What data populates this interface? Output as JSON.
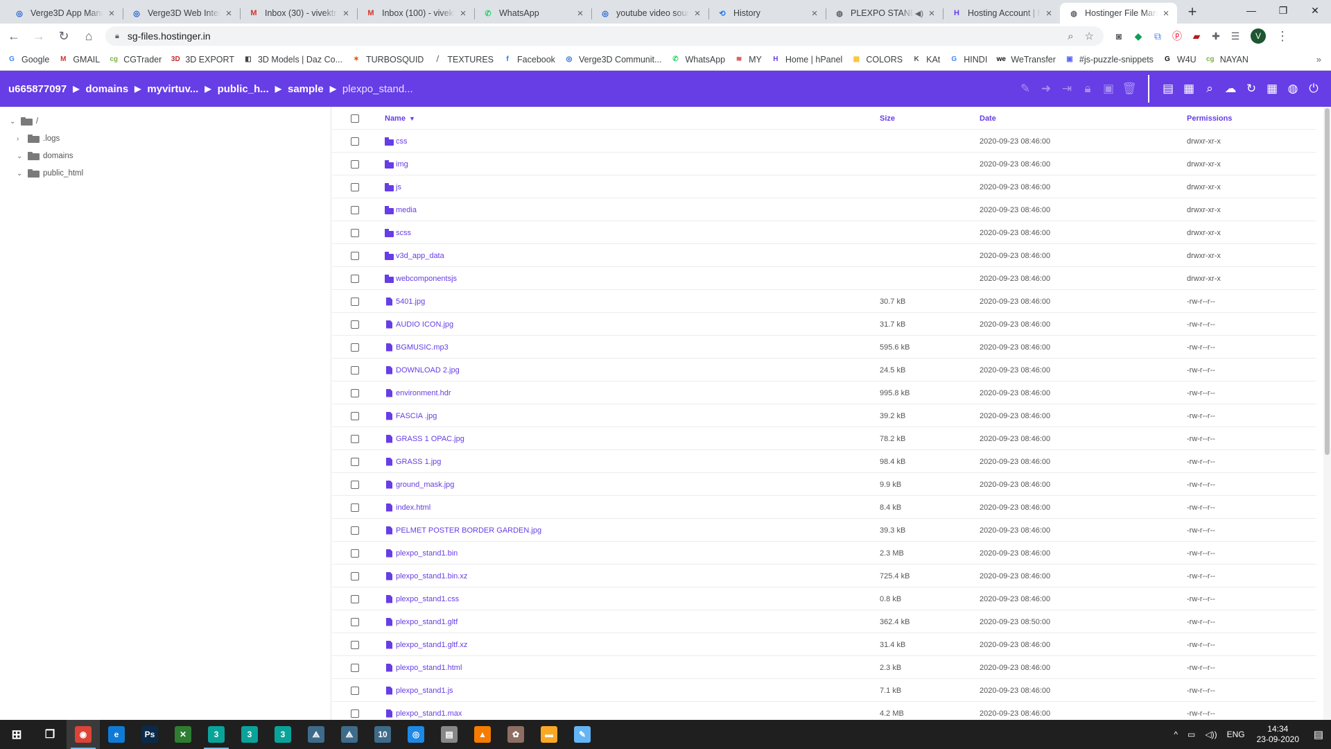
{
  "browser": {
    "tabs": [
      {
        "title": "Verge3D App Mana",
        "icon": "verge3d-icon",
        "glyph": "◎",
        "color": "#1a5fd0"
      },
      {
        "title": "Verge3D Web Inter",
        "icon": "verge3d-icon",
        "glyph": "◎",
        "color": "#1a5fd0"
      },
      {
        "title": "Inbox (30) - vivektr",
        "icon": "gmail-icon",
        "glyph": "M",
        "color": "#d93025"
      },
      {
        "title": "Inbox (100) - vivekt",
        "icon": "gmail-icon",
        "glyph": "M",
        "color": "#d93025"
      },
      {
        "title": "WhatsApp",
        "icon": "whatsapp-icon",
        "glyph": "✆",
        "color": "#25d366"
      },
      {
        "title": "youtube video sour",
        "icon": "verge3d-icon",
        "glyph": "◎",
        "color": "#1a5fd0"
      },
      {
        "title": "History",
        "icon": "history-icon",
        "glyph": "⟲",
        "color": "#1a73e8"
      },
      {
        "title": "PLEXPO STANE",
        "icon": "globe-icon",
        "glyph": "◍",
        "color": "#5f6368",
        "audio": "◀)"
      },
      {
        "title": "Hosting Account | h",
        "icon": "hostinger-icon",
        "glyph": "H",
        "color": "#673de6"
      },
      {
        "title": "Hostinger File Man",
        "icon": "globe-icon",
        "glyph": "◍",
        "color": "#5f6368",
        "active": true
      }
    ],
    "new_tab": "+",
    "address": "sg-files.hostinger.in",
    "profile_initial": "V"
  },
  "bookmarks": [
    {
      "label": "Google",
      "icon": "google-icon",
      "glyph": "G",
      "color": "#4285f4"
    },
    {
      "label": "GMAIL",
      "icon": "gmail-icon",
      "glyph": "M",
      "color": "#d93025"
    },
    {
      "label": "CGTrader",
      "icon": "cgtrader-icon",
      "glyph": "cg",
      "color": "#7cb342"
    },
    {
      "label": "3D EXPORT",
      "icon": "3dexport-icon",
      "glyph": "3D",
      "color": "#c62828"
    },
    {
      "label": "3D Models | Daz Co...",
      "icon": "daz-icon",
      "glyph": "◧",
      "color": "#444"
    },
    {
      "label": "TURBOSQUID",
      "icon": "turbosquid-icon",
      "glyph": "✶",
      "color": "#e65100"
    },
    {
      "label": "TEXTURES",
      "icon": "textures-icon",
      "glyph": "⧸",
      "color": "#555"
    },
    {
      "label": "Facebook",
      "icon": "facebook-icon",
      "glyph": "f",
      "color": "#1877f2"
    },
    {
      "label": "Verge3D Communit...",
      "icon": "verge3d-icon",
      "glyph": "◎",
      "color": "#1a5fd0"
    },
    {
      "label": "WhatsApp",
      "icon": "whatsapp-icon",
      "glyph": "✆",
      "color": "#25d366"
    },
    {
      "label": "MY",
      "icon": "my-icon",
      "glyph": "≋",
      "color": "#c62828"
    },
    {
      "label": "Home | hPanel",
      "icon": "hostinger-icon",
      "glyph": "H",
      "color": "#673de6"
    },
    {
      "label": "COLORS",
      "icon": "colors-icon",
      "glyph": "▦",
      "color": "#fbc02d"
    },
    {
      "label": "KAt",
      "icon": "kat-icon",
      "glyph": "K",
      "color": "#555"
    },
    {
      "label": "HINDI",
      "icon": "google-icon",
      "glyph": "G",
      "color": "#4285f4"
    },
    {
      "label": "WeTransfer",
      "icon": "wetransfer-icon",
      "glyph": "we",
      "color": "#111"
    },
    {
      "label": "#js-puzzle-snippets",
      "icon": "discord-icon",
      "glyph": "▣",
      "color": "#5865f2"
    },
    {
      "label": "W4U",
      "icon": "w4u-icon",
      "glyph": "G",
      "color": "#111"
    },
    {
      "label": "NAYAN",
      "icon": "cgtrader-icon",
      "glyph": "cg",
      "color": "#7cb342"
    }
  ],
  "fm": {
    "breadcrumb": [
      "u665877097",
      "domains",
      "myvirtuv...",
      "public_h...",
      "sample",
      "plexpo_stand..."
    ],
    "accent": "#673de6"
  },
  "tree": [
    {
      "label": "/",
      "caret": "⌄"
    },
    {
      "label": ".logs",
      "caret": "›"
    },
    {
      "label": "domains",
      "caret": "⌄"
    },
    {
      "label": "public_html",
      "caret": "⌄"
    }
  ],
  "table": {
    "headers": {
      "name": "Name",
      "sort": "▼",
      "size": "Size",
      "date": "Date",
      "permissions": "Permissions"
    },
    "rows": [
      {
        "type": "folder",
        "name": "css",
        "size": "",
        "date": "2020-09-23 08:46:00",
        "perm": "drwxr-xr-x"
      },
      {
        "type": "folder",
        "name": "img",
        "size": "",
        "date": "2020-09-23 08:46:00",
        "perm": "drwxr-xr-x"
      },
      {
        "type": "folder",
        "name": "js",
        "size": "",
        "date": "2020-09-23 08:46:00",
        "perm": "drwxr-xr-x"
      },
      {
        "type": "folder",
        "name": "media",
        "size": "",
        "date": "2020-09-23 08:46:00",
        "perm": "drwxr-xr-x"
      },
      {
        "type": "folder",
        "name": "scss",
        "size": "",
        "date": "2020-09-23 08:46:00",
        "perm": "drwxr-xr-x"
      },
      {
        "type": "folder",
        "name": "v3d_app_data",
        "size": "",
        "date": "2020-09-23 08:46:00",
        "perm": "drwxr-xr-x"
      },
      {
        "type": "folder",
        "name": "webcomponentsjs",
        "size": "",
        "date": "2020-09-23 08:46:00",
        "perm": "drwxr-xr-x"
      },
      {
        "type": "file",
        "name": "5401.jpg",
        "size": "30.7 kB",
        "date": "2020-09-23 08:46:00",
        "perm": "-rw-r--r--"
      },
      {
        "type": "file",
        "name": "AUDIO ICON.jpg",
        "size": "31.7 kB",
        "date": "2020-09-23 08:46:00",
        "perm": "-rw-r--r--"
      },
      {
        "type": "file",
        "name": "BGMUSIC.mp3",
        "size": "595.6 kB",
        "date": "2020-09-23 08:46:00",
        "perm": "-rw-r--r--"
      },
      {
        "type": "file",
        "name": "DOWNLOAD 2.jpg",
        "size": "24.5 kB",
        "date": "2020-09-23 08:46:00",
        "perm": "-rw-r--r--"
      },
      {
        "type": "file",
        "name": "environment.hdr",
        "size": "995.8 kB",
        "date": "2020-09-23 08:46:00",
        "perm": "-rw-r--r--"
      },
      {
        "type": "file",
        "name": "FASCIA .jpg",
        "size": "39.2 kB",
        "date": "2020-09-23 08:46:00",
        "perm": "-rw-r--r--"
      },
      {
        "type": "file",
        "name": "GRASS 1 OPAC.jpg",
        "size": "78.2 kB",
        "date": "2020-09-23 08:46:00",
        "perm": "-rw-r--r--"
      },
      {
        "type": "file",
        "name": "GRASS 1.jpg",
        "size": "98.4 kB",
        "date": "2020-09-23 08:46:00",
        "perm": "-rw-r--r--"
      },
      {
        "type": "file",
        "name": "ground_mask.jpg",
        "size": "9.9 kB",
        "date": "2020-09-23 08:46:00",
        "perm": "-rw-r--r--"
      },
      {
        "type": "file",
        "name": "index.html",
        "size": "8.4 kB",
        "date": "2020-09-23 08:46:00",
        "perm": "-rw-r--r--"
      },
      {
        "type": "file",
        "name": "PELMET POSTER BORDER GARDEN.jpg",
        "size": "39.3 kB",
        "date": "2020-09-23 08:46:00",
        "perm": "-rw-r--r--"
      },
      {
        "type": "file",
        "name": "plexpo_stand1.bin",
        "size": "2.3 MB",
        "date": "2020-09-23 08:46:00",
        "perm": "-rw-r--r--"
      },
      {
        "type": "file",
        "name": "plexpo_stand1.bin.xz",
        "size": "725.4 kB",
        "date": "2020-09-23 08:46:00",
        "perm": "-rw-r--r--"
      },
      {
        "type": "file",
        "name": "plexpo_stand1.css",
        "size": "0.8 kB",
        "date": "2020-09-23 08:46:00",
        "perm": "-rw-r--r--"
      },
      {
        "type": "file",
        "name": "plexpo_stand1.gltf",
        "size": "362.4 kB",
        "date": "2020-09-23 08:50:00",
        "perm": "-rw-r--r--"
      },
      {
        "type": "file",
        "name": "plexpo_stand1.gltf.xz",
        "size": "31.4 kB",
        "date": "2020-09-23 08:46:00",
        "perm": "-rw-r--r--"
      },
      {
        "type": "file",
        "name": "plexpo_stand1.html",
        "size": "2.3 kB",
        "date": "2020-09-23 08:46:00",
        "perm": "-rw-r--r--"
      },
      {
        "type": "file",
        "name": "plexpo_stand1.js",
        "size": "7.1 kB",
        "date": "2020-09-23 08:46:00",
        "perm": "-rw-r--r--"
      },
      {
        "type": "file",
        "name": "plexpo_stand1.max",
        "size": "4.2 MB",
        "date": "2020-09-23 08:46:00",
        "perm": "-rw-r--r--"
      }
    ]
  },
  "taskbar": {
    "apps": [
      {
        "name": "chrome",
        "glyph": "◉",
        "color": "#db4437",
        "active": true
      },
      {
        "name": "edge",
        "glyph": "e",
        "color": "#0f7bd6"
      },
      {
        "name": "photoshop",
        "glyph": "Ps",
        "color": "#0b2a4a"
      },
      {
        "name": "xnview",
        "glyph": "✕",
        "color": "#2e7d32"
      },
      {
        "name": "3dsmax-a",
        "glyph": "3",
        "color": "#0aa39a",
        "running": true
      },
      {
        "name": "3dsmax-b",
        "glyph": "3",
        "color": "#0aa39a"
      },
      {
        "name": "3dsmax-c",
        "glyph": "3",
        "color": "#0aa39a"
      },
      {
        "name": "sketchup",
        "glyph": "⟁",
        "color": "#3f6b8a"
      },
      {
        "name": "sketchup-b",
        "glyph": "⟁",
        "color": "#3f6b8a"
      },
      {
        "name": "render-10",
        "glyph": "10",
        "color": "#3f6b8a"
      },
      {
        "name": "screenrec",
        "glyph": "◎",
        "color": "#1e88e5"
      },
      {
        "name": "scanner",
        "glyph": "▤",
        "color": "#888"
      },
      {
        "name": "vlc",
        "glyph": "▲",
        "color": "#f57c00"
      },
      {
        "name": "games",
        "glyph": "✿",
        "color": "#8d6e63"
      },
      {
        "name": "explorer",
        "glyph": "▬",
        "color": "#f9a825"
      },
      {
        "name": "paint",
        "glyph": "✎",
        "color": "#64b5f6"
      }
    ],
    "tray": {
      "chevron": "^",
      "network": "▭",
      "volume": "◁))",
      "lang": "ENG",
      "time": "14:34",
      "date": "23-09-2020",
      "notif": "▤"
    }
  }
}
